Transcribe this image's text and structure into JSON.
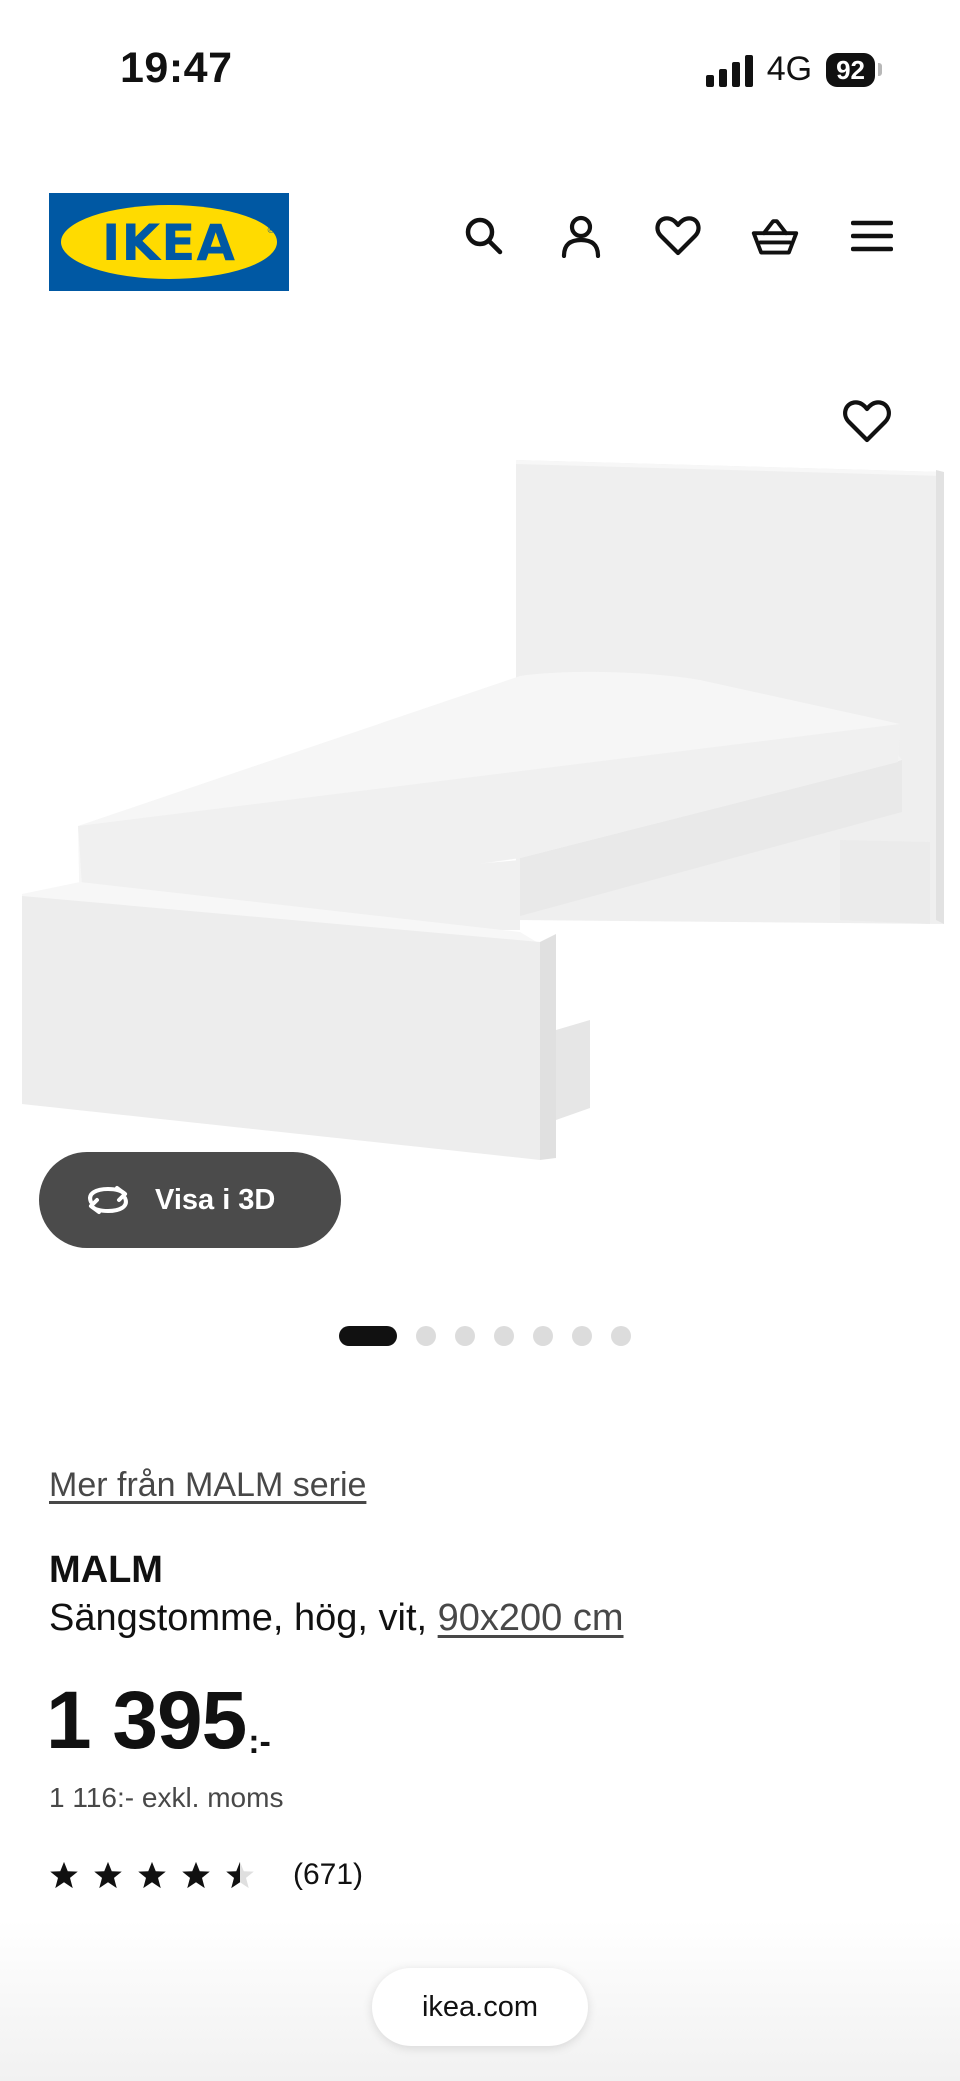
{
  "status_bar": {
    "time": "19:47",
    "network": "4G",
    "battery": "92"
  },
  "header": {
    "logo_text": "IKEA",
    "brand_colors": {
      "blue": "#0058A3",
      "yellow": "#FFDB00"
    },
    "icons": [
      "search-icon",
      "account-icon",
      "favourites-icon",
      "basket-icon",
      "menu-icon"
    ]
  },
  "gallery": {
    "view_3d_label": "Visa i 3D",
    "slide_count": 7,
    "active_slide": 1
  },
  "product": {
    "series_link": "Mer från MALM serie",
    "name": "MALM",
    "description": "Sängstomme, hög, vit, ",
    "size_link": "90x200 cm",
    "price": "1 395",
    "price_suffix": ":-",
    "price_ex_vat": "1 116:- exkl. moms",
    "rating_value": 4.5,
    "rating_max": 5,
    "review_count": "(671)"
  },
  "browser": {
    "url": "ikea.com"
  }
}
